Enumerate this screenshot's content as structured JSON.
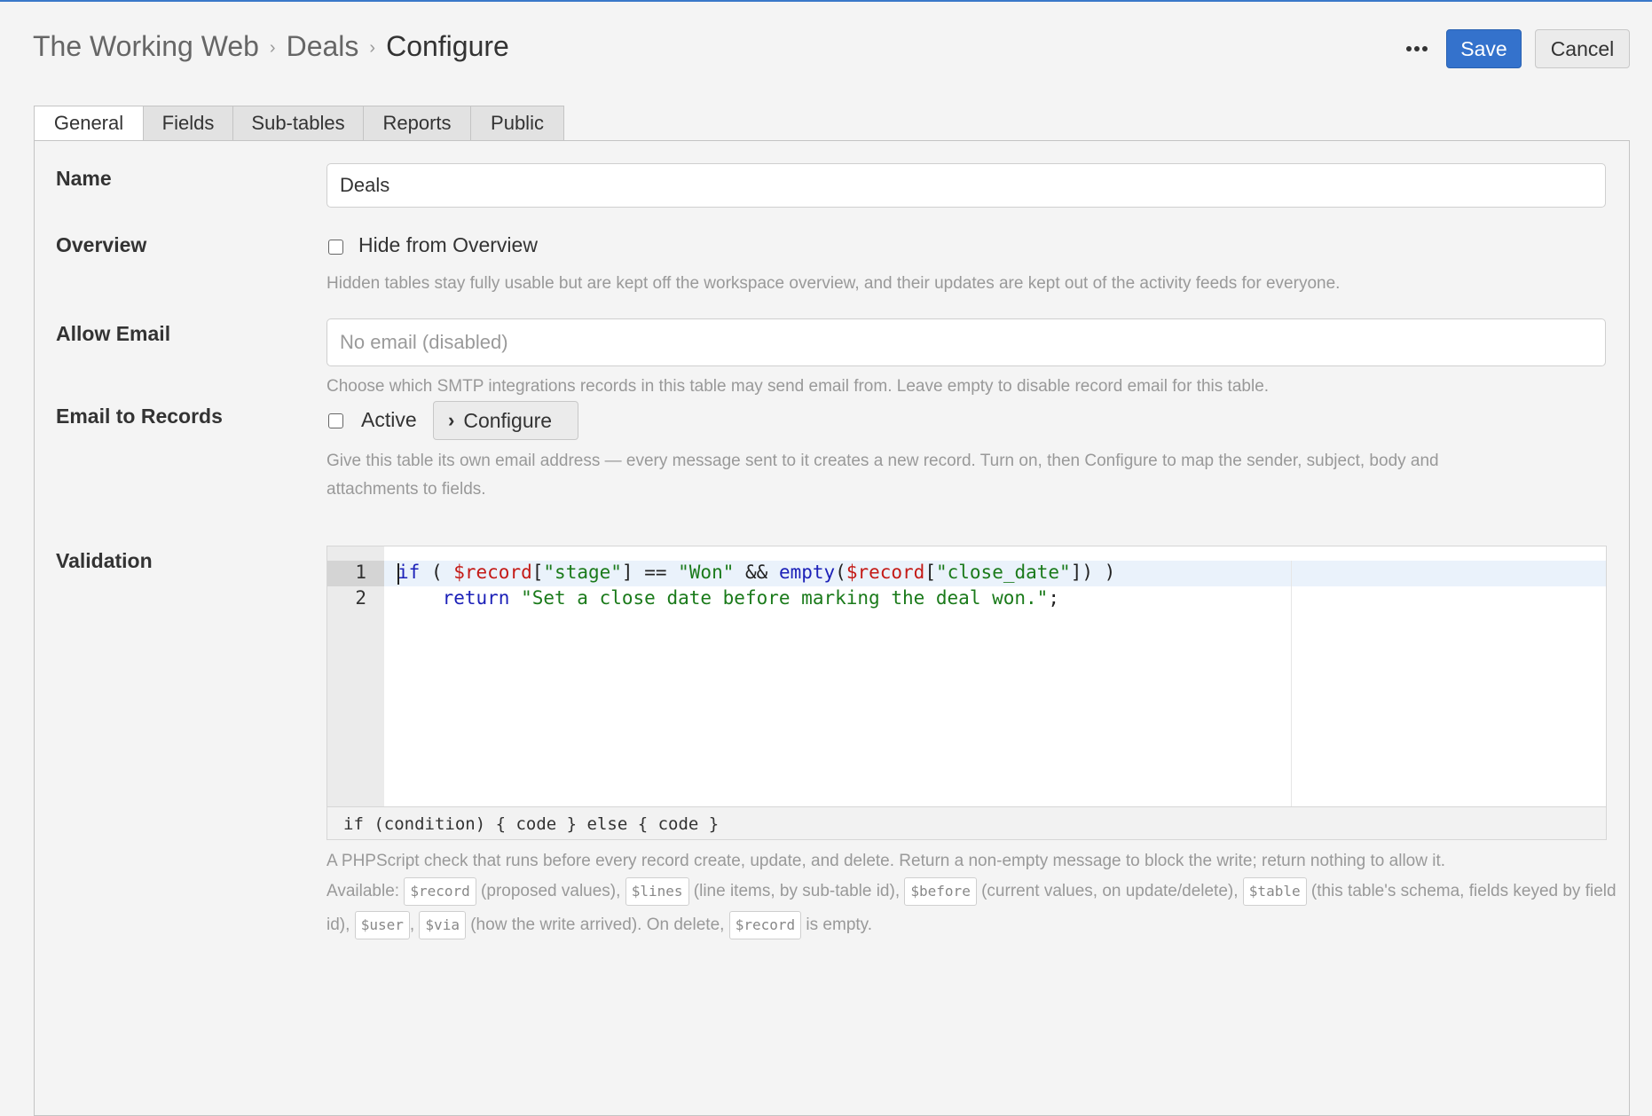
{
  "breadcrumb": {
    "root": "The Working Web",
    "parent": "Deals",
    "current": "Configure",
    "separator": "›"
  },
  "toolbar": {
    "more_icon": "ellipsis-icon",
    "save_label": "Save",
    "cancel_label": "Cancel"
  },
  "colors": {
    "accent": "#3472cc",
    "keyword": "#1c21b8",
    "variable": "#c41a16",
    "string": "#1a7a1a"
  },
  "tabs": [
    {
      "label": "General",
      "active": true
    },
    {
      "label": "Fields"
    },
    {
      "label": "Sub-tables"
    },
    {
      "label": "Reports"
    },
    {
      "label": "Public"
    }
  ],
  "form": {
    "name": {
      "label": "Name",
      "value": "Deals"
    },
    "overview": {
      "label": "Overview",
      "checkbox_label": "Hide from Overview",
      "checked": false,
      "help": "Hidden tables stay fully usable but are kept off the workspace overview, and their updates are kept out of the activity feeds for everyone."
    },
    "allow_email": {
      "label": "Allow Email",
      "value": "",
      "placeholder": "No email (disabled)",
      "help": "Choose which SMTP integrations records in this table may send email from. Leave empty to disable record email for this table."
    },
    "email_to_records": {
      "label": "Email to Records",
      "checkbox_label": "Active",
      "checked": false,
      "configure_label": "Configure",
      "configure_icon": "chevron-right-icon",
      "help_line1": "Give this table its own email address — every message sent to it creates a new record. Turn on, then Configure to map the sender, subject, body and",
      "help_line2": "attachments to fields."
    },
    "validation": {
      "label": "Validation",
      "line_numbers": [
        "1",
        "2"
      ],
      "status_hint": "if (condition) { code } else { code }",
      "help": {
        "line1": "A PHPScript check that runs before every record create, update, and delete. Return a non-empty message to block the write; return nothing to allow it.",
        "available": "Available:",
        "var_record": "$record",
        "t_record": "(proposed values),",
        "var_lines": "$lines",
        "t_lines": "(line items, by sub-table id),",
        "var_before": "$before",
        "t_before": "(current values, on update/delete),",
        "var_table": "$table",
        "t_table": "(this table's schema,",
        "t_fields": "fields keyed by field id),",
        "var_user": "$user",
        "comma": ",",
        "var_via": "$via",
        "t_via": "(how the write arrived). On delete,",
        "var_record2": "$record",
        "t_empty": "is empty."
      }
    }
  }
}
